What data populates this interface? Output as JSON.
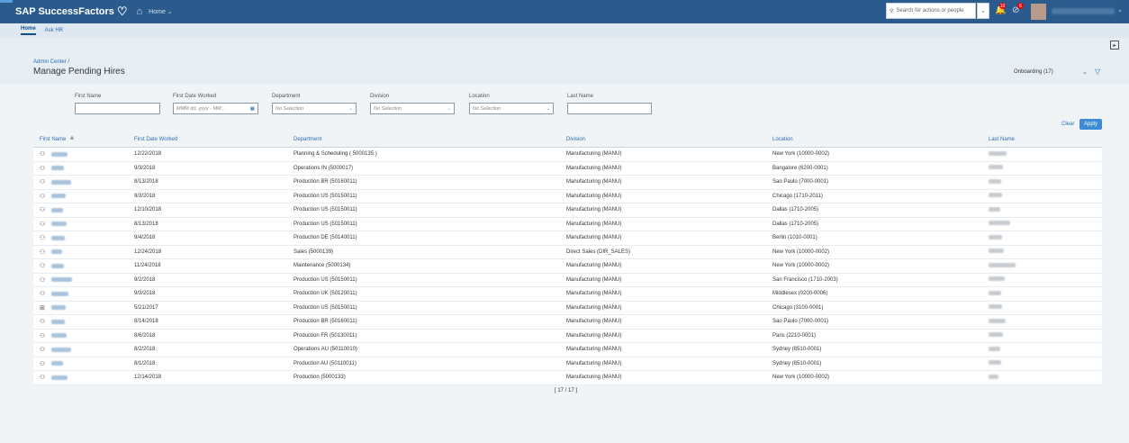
{
  "brand": {
    "name": "SAP SuccessFactors"
  },
  "topnav": {
    "home_label": "Home"
  },
  "search": {
    "placeholder": "Search for actions or people"
  },
  "notifications": {
    "bell_count": "10",
    "todo_count": "6"
  },
  "subnav": {
    "tabs": [
      "Home",
      "Ask HR"
    ]
  },
  "header": {
    "breadcrumb": "Admin Center /",
    "title": "Manage Pending Hires",
    "variant": "Onboarding (17)"
  },
  "filters": {
    "first_name_label": "First Name",
    "first_date_label": "First Date Worked",
    "first_date_placeholder": "MMM dd, yyyy - MM...",
    "department_label": "Department",
    "department_value": "No Selection",
    "division_label": "Division",
    "division_value": "No Selection",
    "location_label": "Location",
    "location_value": "No Selection",
    "last_name_label": "Last Name",
    "clear_label": "Clear",
    "apply_label": "Apply"
  },
  "table": {
    "columns": [
      "First Name",
      "First Date Worked",
      "Department",
      "Division",
      "Location",
      "Last Name"
    ],
    "rows": [
      {
        "date": "12/22/2018",
        "dept": "Planning & Scheduling ( 5000135 )",
        "div": "Manufacturing (MANU)",
        "loc": "New York (10000-0002)",
        "icon": "person-add-icon"
      },
      {
        "date": "9/3/2018",
        "dept": "Operations IN (5000017)",
        "div": "Manufacturing (MANU)",
        "loc": "Bangalore (6200-0001)",
        "icon": "person-add-icon"
      },
      {
        "date": "8/13/2018",
        "dept": "Production BR (50160011)",
        "div": "Manufacturing (MANU)",
        "loc": "Sao Paulo (7000-0001)",
        "icon": "person-add-icon"
      },
      {
        "date": "9/3/2018",
        "dept": "Production US (50150011)",
        "div": "Manufacturing (MANU)",
        "loc": "Chicago (1710-2011)",
        "icon": "person-add-icon"
      },
      {
        "date": "12/10/2018",
        "dept": "Production US (50150011)",
        "div": "Manufacturing (MANU)",
        "loc": "Dallas (1710-2005)",
        "icon": "person-add-icon"
      },
      {
        "date": "8/13/2018",
        "dept": "Production US (50150011)",
        "div": "Manufacturing (MANU)",
        "loc": "Dallas (1710-2005)",
        "icon": "person-add-icon"
      },
      {
        "date": "9/4/2018",
        "dept": "Production DE (50140011)",
        "div": "Manufacturing (MANU)",
        "loc": "Berlin (1010-0001)",
        "icon": "person-add-icon"
      },
      {
        "date": "12/24/2018",
        "dept": "Sales (5000139)",
        "div": "Direct Sales (DIR_SALES)",
        "loc": "New York (10000-0002)",
        "icon": "person-add-icon"
      },
      {
        "date": "11/24/2018",
        "dept": "Maintenance (5000134)",
        "div": "Manufacturing (MANU)",
        "loc": "New York (10000-0002)",
        "icon": "person-add-icon"
      },
      {
        "date": "9/2/2018",
        "dept": "Production US (50150011)",
        "div": "Manufacturing (MANU)",
        "loc": "San Francisco (1710-2003)",
        "icon": "person-add-icon"
      },
      {
        "date": "9/3/2018",
        "dept": "Production UK (50120011)",
        "div": "Manufacturing (MANU)",
        "loc": "Middlesex (0200-0006)",
        "icon": "person-add-icon"
      },
      {
        "date": "5/21/2017",
        "dept": "Production US (50150011)",
        "div": "Manufacturing (MANU)",
        "loc": "Chicago (3100-0001)",
        "icon": "org-chart-icon"
      },
      {
        "date": "8/14/2018",
        "dept": "Production BR (50160011)",
        "div": "Manufacturing (MANU)",
        "loc": "Sao Paulo (7000-0001)",
        "icon": "person-add-icon"
      },
      {
        "date": "8/6/2018",
        "dept": "Production FR (50130011)",
        "div": "Manufacturing (MANU)",
        "loc": "Paris (2210-0001)",
        "icon": "person-add-icon"
      },
      {
        "date": "8/2/2018",
        "dept": "Operations AU (50110010)",
        "div": "Manufacturing (MANU)",
        "loc": "Sydney (8510-0001)",
        "icon": "person-add-icon"
      },
      {
        "date": "8/1/2018",
        "dept": "Production AU (50110011)",
        "div": "Manufacturing (MANU)",
        "loc": "Sydney (8510-0001)",
        "icon": "person-add-icon"
      },
      {
        "date": "12/14/2018",
        "dept": "Production (5000133)",
        "div": "Manufacturing (MANU)",
        "loc": "New York (10000-0002)",
        "icon": "person-add-icon"
      }
    ]
  },
  "pager": {
    "text": "[ 17 / 17 ]"
  }
}
